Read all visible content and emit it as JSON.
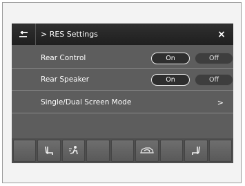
{
  "header": {
    "title": "> RES Settings",
    "back_icon": "return-arrow-icon",
    "close_label": "×"
  },
  "rows": [
    {
      "label": "Rear Control",
      "on_label": "On",
      "off_label": "Off",
      "selected": "On"
    },
    {
      "label": "Rear Speaker",
      "on_label": "On",
      "off_label": "Off",
      "selected": "On"
    },
    {
      "label": "Single/Dual Screen Mode",
      "chevron": ">"
    }
  ],
  "bottom_bar": {
    "buttons": [
      {
        "icon": "blank"
      },
      {
        "icon": "seat-heater-left-icon"
      },
      {
        "icon": "fan-mode-icon"
      },
      {
        "icon": "blank"
      },
      {
        "icon": "blank"
      },
      {
        "icon": "recirculation-car-icon"
      },
      {
        "icon": "blank"
      },
      {
        "icon": "seat-heater-right-icon"
      },
      {
        "icon": "blank"
      }
    ]
  },
  "colors": {
    "screen_bg": "#5d5d5d",
    "header_bg": "#262626",
    "text": "#ffffff"
  }
}
